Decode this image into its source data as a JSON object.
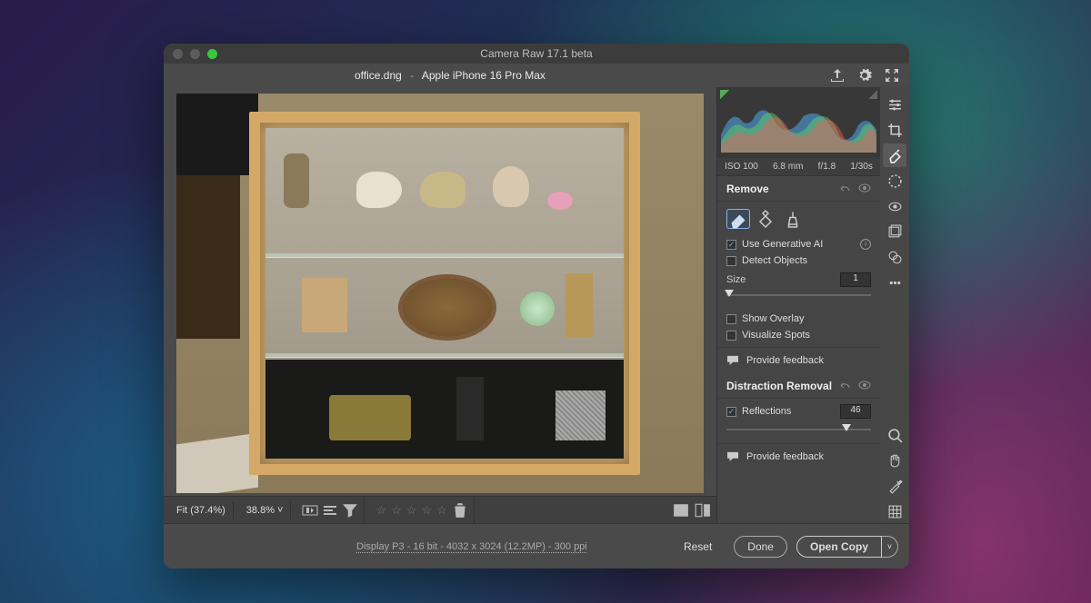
{
  "window": {
    "title": "Camera Raw 17.1 beta"
  },
  "file": {
    "name": "office.dng",
    "device": "Apple iPhone 16 Pro Max"
  },
  "meta": {
    "iso": "ISO 100",
    "focal": "6.8 mm",
    "aperture": "f/1.8",
    "shutter": "1/30s"
  },
  "remove": {
    "title": "Remove",
    "use_gen_ai": "Use Generative AI",
    "detect_objects": "Detect Objects",
    "size_label": "Size",
    "size_value": "1",
    "show_overlay": "Show Overlay",
    "visualize_spots": "Visualize Spots",
    "feedback": "Provide feedback"
  },
  "distraction": {
    "title": "Distraction Removal",
    "reflections": "Reflections",
    "value": "46",
    "feedback": "Provide feedback"
  },
  "view": {
    "fit": "Fit (37.4%)",
    "zoom": "38.8%"
  },
  "footer": {
    "info": "Display P3 - 16 bit - 4032 x 3024 (12.2MP) - 300 ppi",
    "reset": "Reset",
    "done": "Done",
    "open_copy": "Open Copy"
  }
}
